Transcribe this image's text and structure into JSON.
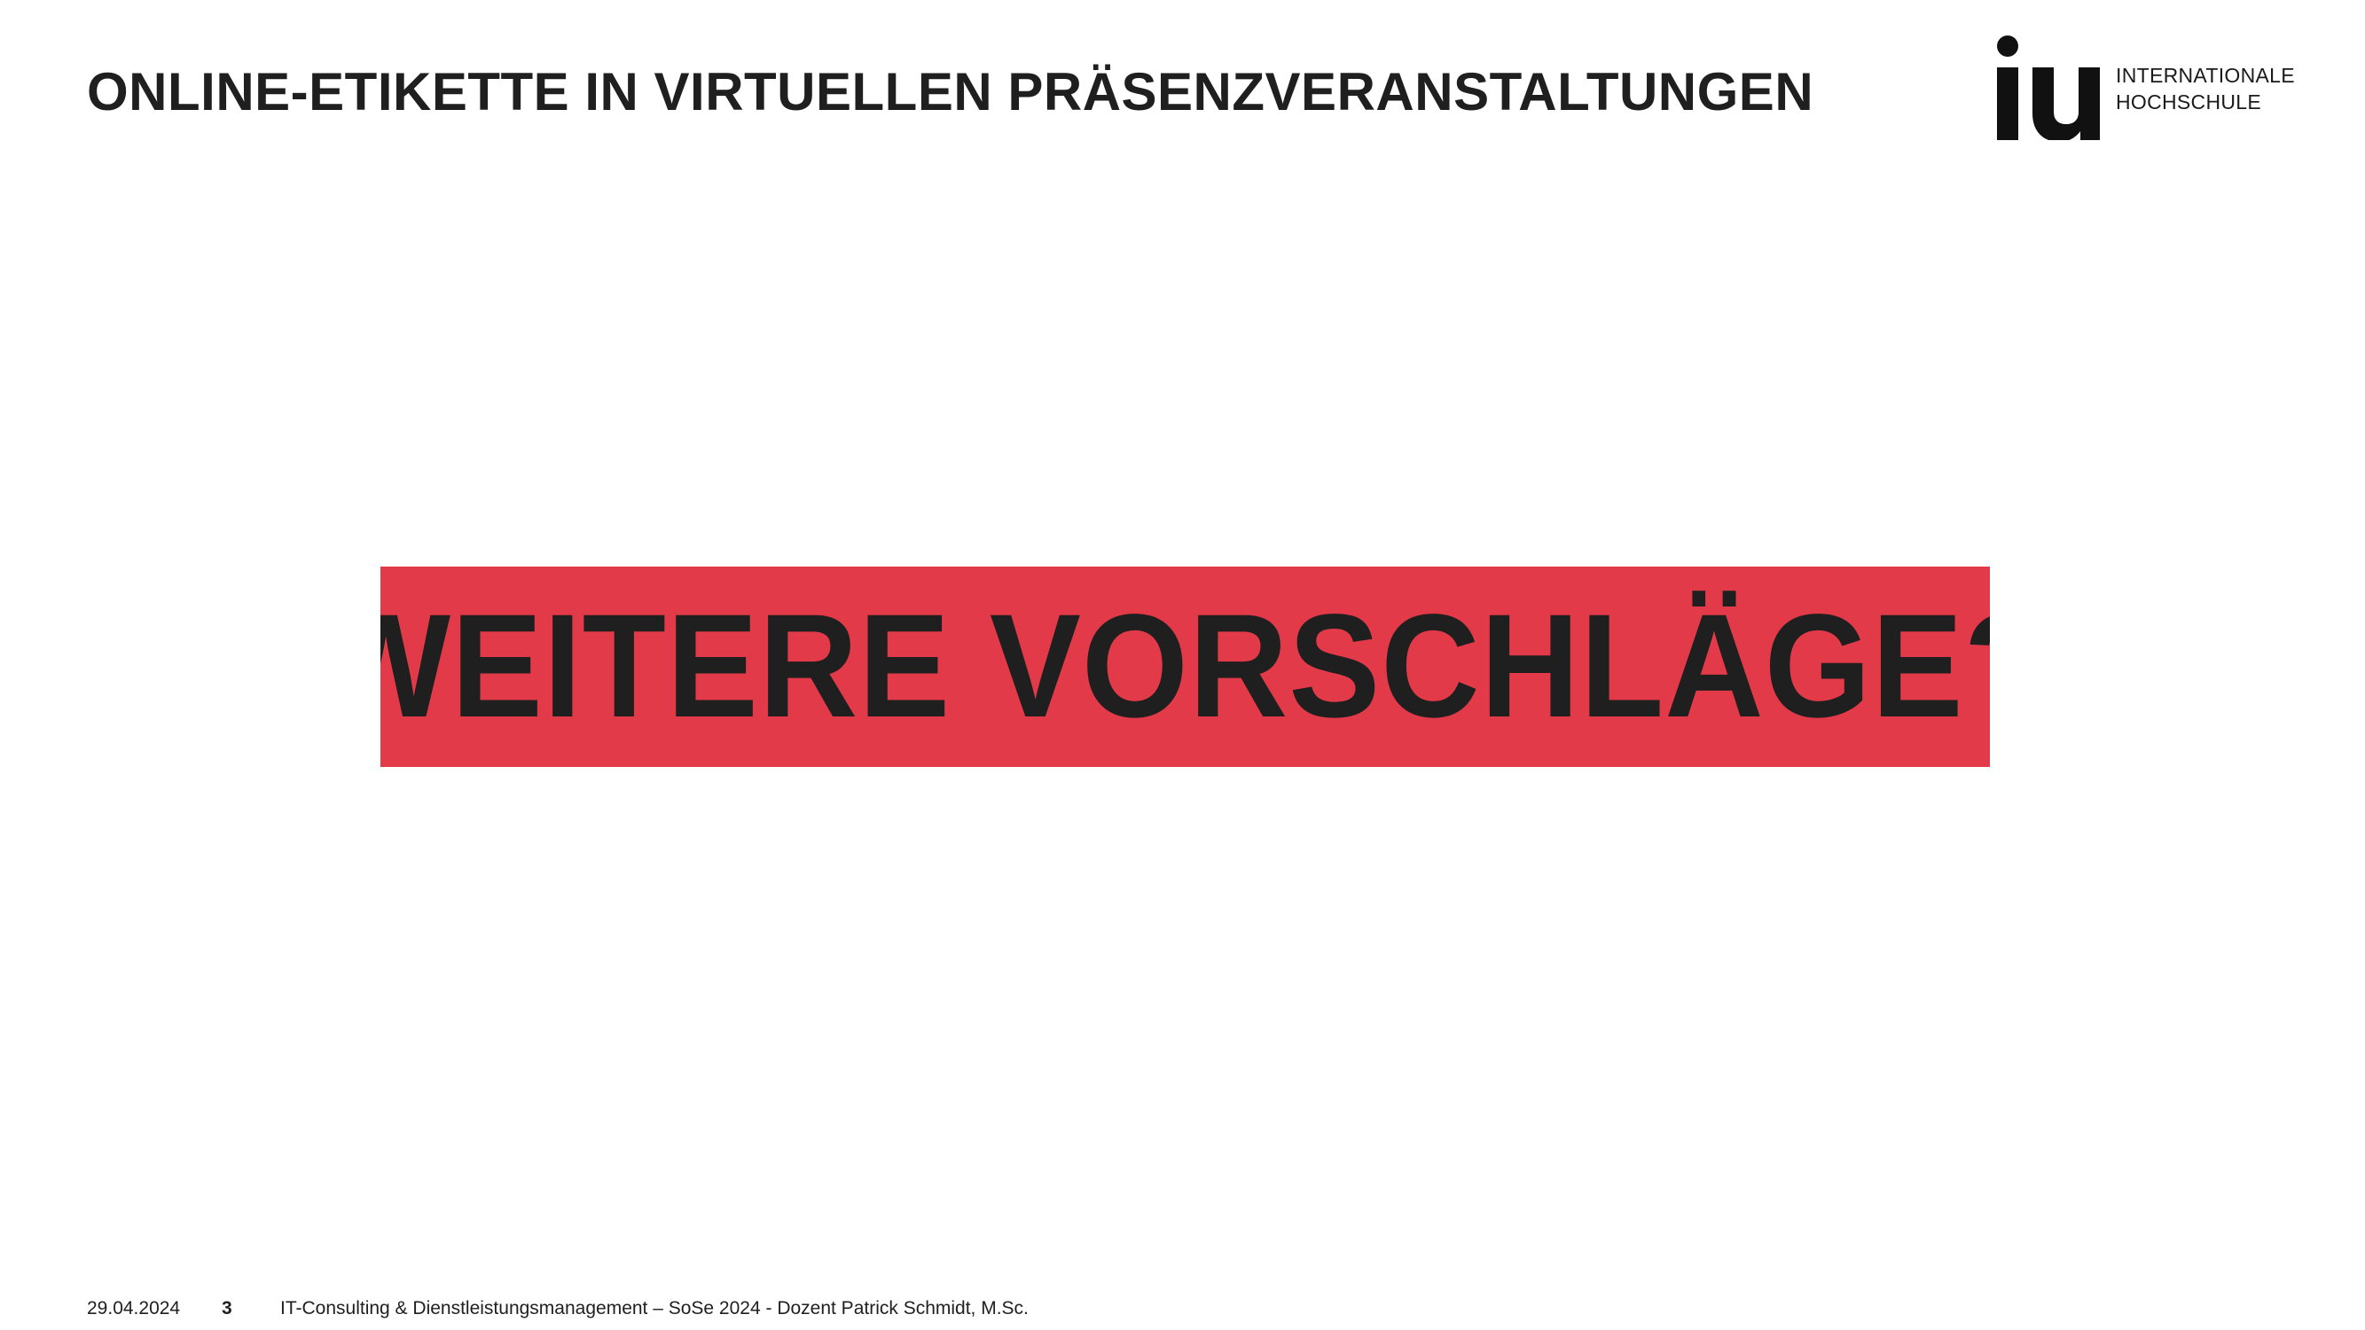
{
  "slide": {
    "title": "ONLINE-ETIKETTE IN VIRTUELLEN PRÄSENZVERANSTALTUNGEN",
    "callout_text": "WEITERE VORSCHLÄGE?",
    "accent_color": "#e33a49"
  },
  "logo": {
    "mark": "iu",
    "line1": "INTERNATIONALE",
    "line2": "HOCHSCHULE"
  },
  "footer": {
    "date": "29.04.2024",
    "page": "3",
    "course": "IT-Consulting & Dienstleistungsmanagement – SoSe 2024 - Dozent Patrick Schmidt, M.Sc."
  }
}
